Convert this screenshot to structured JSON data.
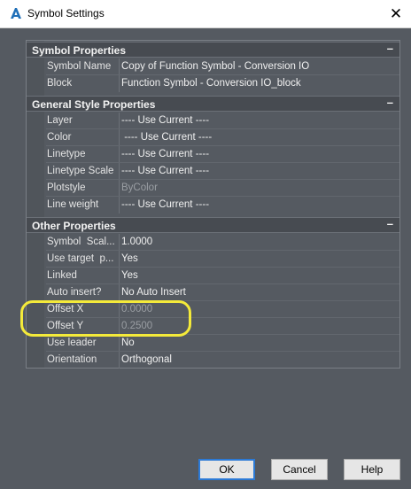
{
  "window": {
    "title": "Symbol Settings"
  },
  "sections": [
    {
      "title": "Symbol Properties",
      "toggle": "–",
      "rows": [
        {
          "label": "Symbol Name",
          "value": "Copy of Function Symbol - Conversion IO"
        },
        {
          "label": "Block",
          "value": "Function Symbol - Conversion IO_block"
        }
      ]
    },
    {
      "title": "General Style Properties",
      "toggle": "–",
      "rows": [
        {
          "label": "Layer",
          "value": "---- Use Current ----"
        },
        {
          "label": "Color",
          "value": " ---- Use Current ----"
        },
        {
          "label": "Linetype",
          "value": "---- Use Current ----"
        },
        {
          "label": "Linetype Scale",
          "value": "---- Use Current ----"
        },
        {
          "label": "Plotstyle",
          "value": "ByColor"
        },
        {
          "label": "Line weight",
          "value": "---- Use Current ----"
        }
      ]
    },
    {
      "title": "Other Properties",
      "toggle": "–",
      "rows": [
        {
          "label": "Symbol  Scal...",
          "value": "1.0000"
        },
        {
          "label": "Use target  p...",
          "value": "Yes"
        },
        {
          "label": "Linked",
          "value": "Yes"
        },
        {
          "label": "Auto insert?",
          "value": "No Auto Insert"
        },
        {
          "label": "Offset X",
          "value": "0.0000"
        },
        {
          "label": "Offset Y",
          "value": "0.2500"
        },
        {
          "label": "Use leader",
          "value": "No"
        },
        {
          "label": "Orientation",
          "value": "Orthogonal"
        }
      ]
    }
  ],
  "buttons": {
    "ok": "OK",
    "cancel": "Cancel",
    "help": "Help"
  },
  "colors": {
    "highlight": "#f4ea3a",
    "default_button_border": "#2c7ad6"
  }
}
